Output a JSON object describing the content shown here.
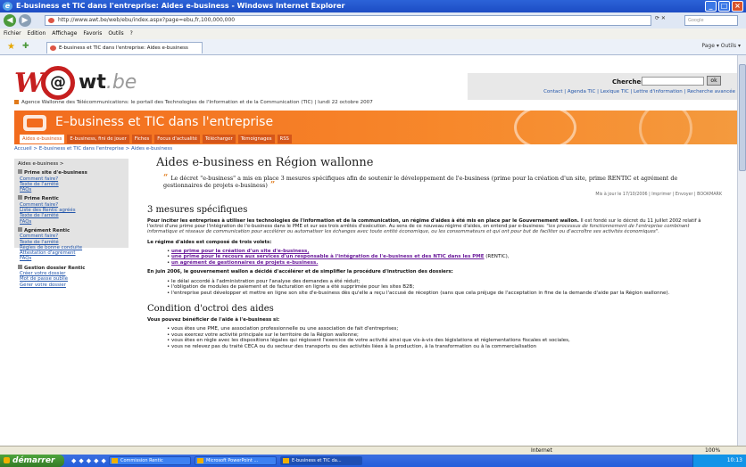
{
  "window": {
    "title": "E-business et TIC dans l'entreprise: Aides e-business - Windows Internet Explorer"
  },
  "address": {
    "url": "http://www.awt.be/web/ebu/index.aspx?page=ebu,fr,100,000,000",
    "search_placeholder": "Google"
  },
  "menu": [
    "Fichier",
    "Edition",
    "Affichage",
    "Favoris",
    "Outils",
    "?"
  ],
  "tab": {
    "label": "E-business et TIC dans l'entreprise: Aides e-business"
  },
  "toolbar": {
    "tools_text": "Page ▾  Outils ▾"
  },
  "site": {
    "logo_w": "W",
    "logo_at": "@",
    "logo_name": "wt",
    "logo_ext": ".be",
    "search_label": "Chercher",
    "search_button": "ok",
    "top_links": "Contact | Agenda TIC | Lexique TIC | Lettre d'information | Recherche avancée",
    "announcement": "Agence Wallonne des Télécommunications: le portail des Technologies de l'Information et de la Communication (TIC) | lundi 22 octobre 2007",
    "banner_title": "E–business et TIC dans l'entreprise",
    "nav_tabs": [
      "Aides e-business",
      "E-business, fini de jouer",
      "Fiches",
      "Focus d'actualité",
      "Télécharger",
      "Témoignages",
      "RSS"
    ],
    "breadcrumb": "Accueil > E-business et TIC dans l'entreprise > Aides e-business"
  },
  "sidebar": {
    "title": "Aides e-business >",
    "sections": [
      {
        "name": "Prime site d'e-business",
        "links": [
          "Comment faire?",
          "Texte de l'arrêté",
          "FAQs"
        ]
      },
      {
        "name": "Prime Rentic",
        "links": [
          "Comment faire?",
          "Liste des Rentic agréés",
          "Texte de l'arrêté",
          "FAQs"
        ]
      },
      {
        "name": "Agrément Rentic",
        "links": [
          "Comment faire?",
          "Texte de l'arrêté",
          "Règles de bonne conduite",
          "Attestation d'agrément",
          "FAQs"
        ]
      },
      {
        "name": "Gestion dossier Rentic",
        "links": [
          "Créer votre dossier",
          "Mot de passe oublié",
          "Gérer votre dossier"
        ]
      }
    ]
  },
  "main": {
    "title": "Aides e-business en Région wallonne",
    "intro": "Le décret \"e-business\" a mis en place 3 mesures spécifiques afin de soutenir le développement de l'e-business (prime pour la création d'un site, prime RENTIC et agrément de gestionnaires de projets e-business)",
    "meta": "Mis à jour le 17/10/2006 | Imprimer | Envoyer | BOOKMARK",
    "h2_mesures": "3 mesures spécifiques",
    "p1_bold": "Pour inciter les entreprises à utiliser les technologies de l'information et de la communication, un régime d'aides à été mis en place par le Gouvernement wallon.",
    "p1_rest": " Il est fondé sur le décret du 11 juillet 2002 relatif à l'octroi d'une prime pour l'intégration de l'e-business dans le PME et sur ses trois arrêtés d'exécution. Au sens de ce nouveau régime d'aides, on entend par e-business: ",
    "p1_italic": "\"les processus de fonctionnement de l'entreprise combinant informatique et réseaux de communication pour accélérer ou automatiser les échanges avec toute entité économique, ou les consommateurs et qui ont pour but de faciliter ou d'accroître ses activités économiques\".",
    "p2": "Le régime d'aides est composé de trois volets:",
    "volets": [
      "une prime pour la création d'un site d'e-business,",
      "une prime pour le recours aux services d'un responsable à l'intégration de l'e-business et des NTIC dans les PME",
      "un agrément de gestionnaires de projets e-business."
    ],
    "volet2_suffix": " (RENTIC),",
    "p3": "En juin 2006, le gouvernement wallon a décidé d'accélérer et de simplifier la procédure d'instruction des dossiers:",
    "juin_items": [
      "le délai accordé à l'administration pour l'analyse des demandes a été réduit;",
      "l'obligation de modules de paiement et de facturation en ligne a été supprimée pour les sites B2B;",
      "l'entreprise peut développer et mettre en ligne son site d'e-business dès qu'elle a reçu l'accusé de réception (sans que cela préjuge de l'acceptation in fine de la demande d'aide par la Région wallonne)."
    ],
    "h2_condition": "Condition d'octroi des aides",
    "p4": "Vous pouvez bénéficier de l'aide à l'e-business si:",
    "cond_items": [
      "vous êtes une PME, une association professionnelle ou une association de fait d'entreprises;",
      "vous exercez votre activité principale sur le territoire de la Région wallonne;",
      "vous êtes en règle avec les dispositions légales qui régissent l'exercice de votre activité ainsi que vis-à-vis des législations et réglementations fiscales et sociales,",
      "vous ne relevez pas du traité CECA ou du secteur des transports ou des activités liées à la production, à la transformation ou à la commercialisation"
    ]
  },
  "status": {
    "zone": "Internet",
    "zoom": "100%"
  },
  "taskbar": {
    "start": "démarrer",
    "items": [
      "Commission Rentic",
      "Microsoft PowerPoint ...",
      "E-business et TIC da..."
    ],
    "time": "10:13"
  }
}
